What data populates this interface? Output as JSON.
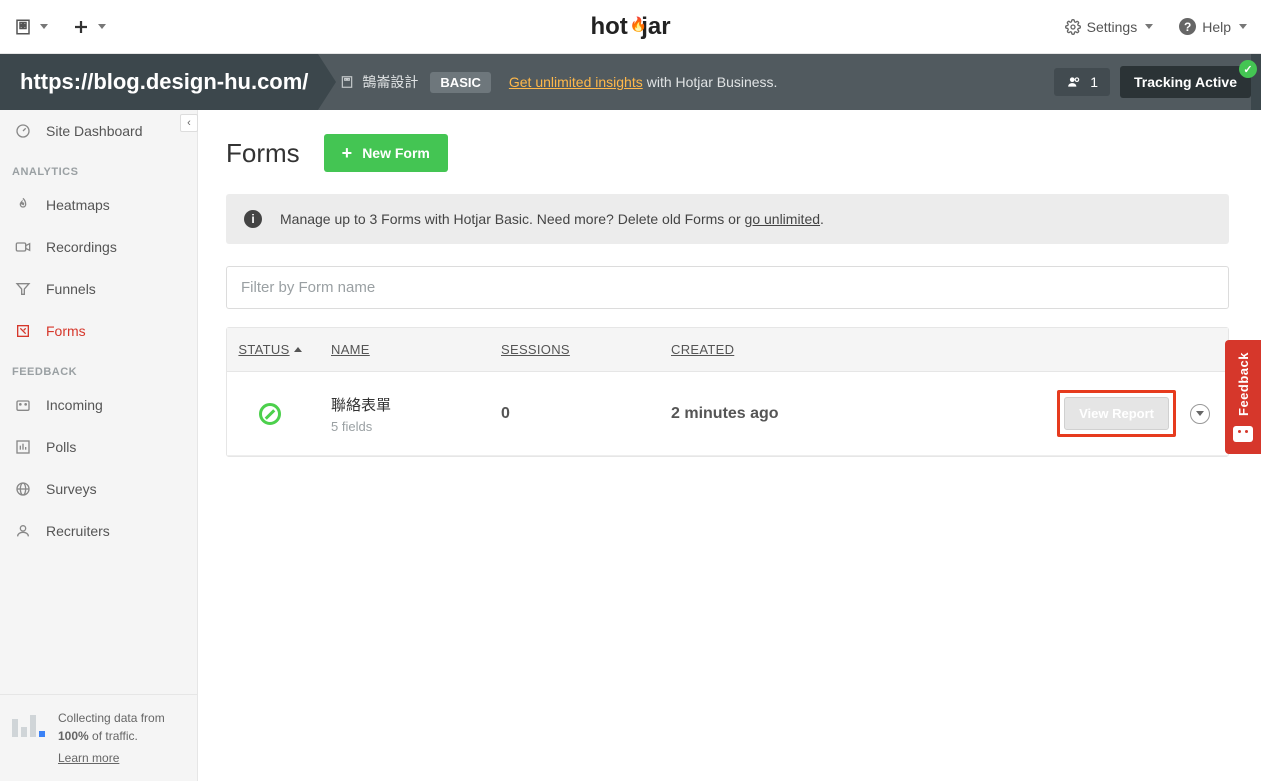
{
  "topbar": {
    "settings_label": "Settings",
    "help_label": "Help"
  },
  "urlstrip": {
    "url": "https://blog.design-hu.com/",
    "site_name": "鵠崙設計",
    "plan_badge": "BASIC",
    "unlimited_link": "Get unlimited insights",
    "unlimited_suffix": "with Hotjar Business.",
    "user_count": "1",
    "tracking_label": "Tracking Active"
  },
  "sidebar": {
    "dashboard": "Site Dashboard",
    "section_analytics": "ANALYTICS",
    "heatmaps": "Heatmaps",
    "recordings": "Recordings",
    "funnels": "Funnels",
    "forms": "Forms",
    "section_feedback": "FEEDBACK",
    "incoming": "Incoming",
    "polls": "Polls",
    "surveys": "Surveys",
    "recruiters": "Recruiters",
    "footer_line1": "Collecting data from",
    "footer_bold": "100%",
    "footer_line2": " of traffic.",
    "footer_learn": "Learn more"
  },
  "page": {
    "title": "Forms",
    "new_button": "New Form",
    "notice_prefix": "Manage up to 3 Forms with Hotjar Basic. Need more? Delete old Forms or ",
    "notice_link": "go unlimited",
    "filter_placeholder": "Filter by Form name",
    "columns": {
      "status": "STATUS",
      "name": "NAME",
      "sessions": "SESSIONS",
      "created": "CREATED"
    },
    "rows": [
      {
        "name": "聯絡表單",
        "subtitle": "5 fields",
        "sessions": "0",
        "created": "2 minutes ago",
        "action_label": "View Report"
      }
    ]
  },
  "feedback_tab": "Feedback"
}
